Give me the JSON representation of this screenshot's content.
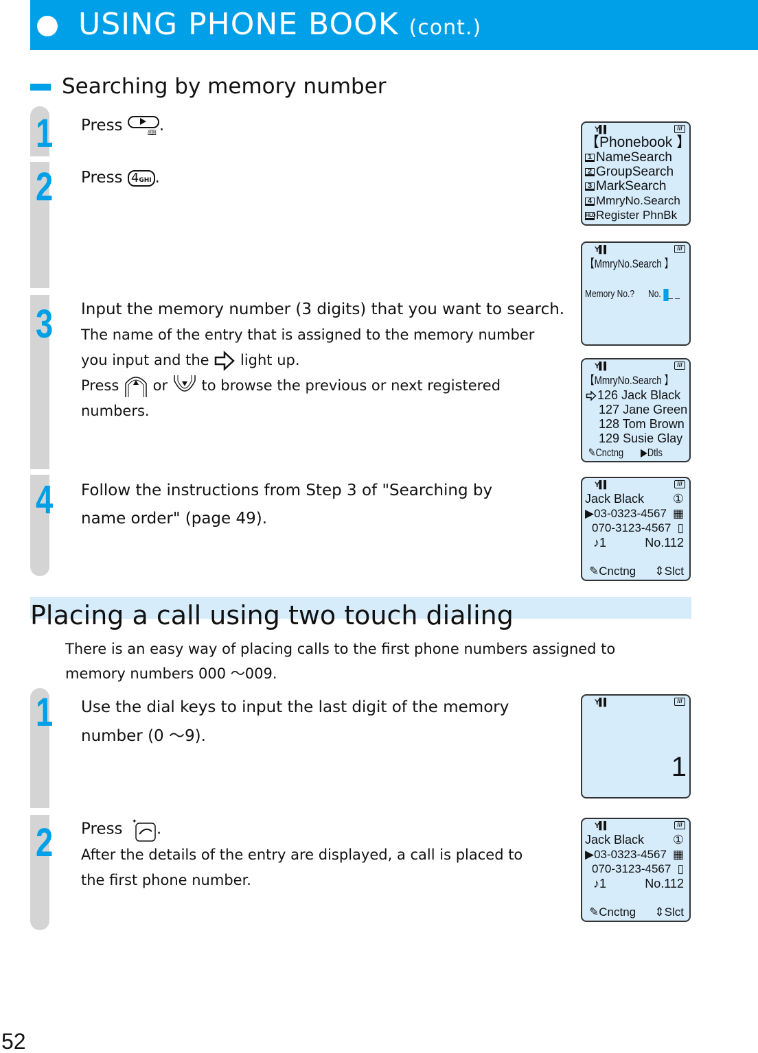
{
  "header": {
    "title": "USING PHONE BOOK",
    "suffix": "(cont.)"
  },
  "section1": {
    "heading": "Searching by memory number",
    "steps": [
      {
        "num": "1",
        "prefix": "Press",
        "key": "right-phonebook-key",
        "suffix": "."
      },
      {
        "num": "2",
        "prefix": "Press",
        "key_label": "4",
        "key_sub": "GHI",
        "suffix": "."
      },
      {
        "num": "3",
        "line1": "Input the memory number (3 digits) that you want to search.",
        "line2": "The name of the entry that is assigned to the memory number",
        "line3a": "you input and the",
        "line3b": "light up.",
        "line4a": "Press",
        "line4b": "or",
        "line4c": "to browse the previous or next registered",
        "line5": "numbers."
      },
      {
        "num": "4",
        "line1": "Follow the instructions from Step 3 of \"Searching by",
        "line2": "name order\" (page 49)."
      }
    ]
  },
  "screens": {
    "phonebook_menu": {
      "title": "【Phonebook 】",
      "items": [
        {
          "key": "1",
          "label": "NameSearch"
        },
        {
          "key": "2",
          "label": "GroupSearch"
        },
        {
          "key": "3",
          "label": "MarkSearch"
        },
        {
          "key": "4",
          "label": "MmryNo.Search"
        },
        {
          "key": "HLD",
          "label": "Register PhnBk"
        }
      ]
    },
    "mmry_input": {
      "title": "【MmryNo.Search 】",
      "prompt": "Memory No.?",
      "no_label": "No.",
      "placeholder": "_ _"
    },
    "mmry_list": {
      "title": "【MmryNo.Search 】",
      "entries": [
        {
          "no": "126",
          "name": "Jack Black",
          "selected": true
        },
        {
          "no": "127",
          "name": "Jane Green",
          "selected": false
        },
        {
          "no": "128",
          "name": "Tom Brown",
          "selected": false
        },
        {
          "no": "129",
          "name": "Susie Glay",
          "selected": false
        }
      ],
      "softkey_left": "Cnctng",
      "softkey_right": "Dtls"
    },
    "detail": {
      "name": "Jack Black",
      "group": "①",
      "phone1": "03-0323-4567",
      "phone2": "070-3123-4567",
      "ringtone": "1",
      "memory_no": "No.112",
      "softkey_left": "Cnctng",
      "softkey_right": "Slct"
    },
    "dial_digit": {
      "digit": "1"
    }
  },
  "section2": {
    "title": "Placing a call using two touch dialing",
    "intro_line1": "There is an easy way of placing calls to the first phone numbers assigned to",
    "intro_line2": "memory numbers 000 ～009.",
    "steps": [
      {
        "num": "1",
        "line1": "Use the dial keys to input the last digit of the memory",
        "line2": "number (0 ～9)."
      },
      {
        "num": "2",
        "prefix": "Press",
        "suffix": ".",
        "line2": "After the details of the entry are displayed, a call is placed to",
        "line3": "the first phone number."
      }
    ]
  },
  "page_number": "52",
  "colors": {
    "accent": "#00a0e9",
    "lcd": "#d6ecfb",
    "rail": "#d4d4d4"
  }
}
